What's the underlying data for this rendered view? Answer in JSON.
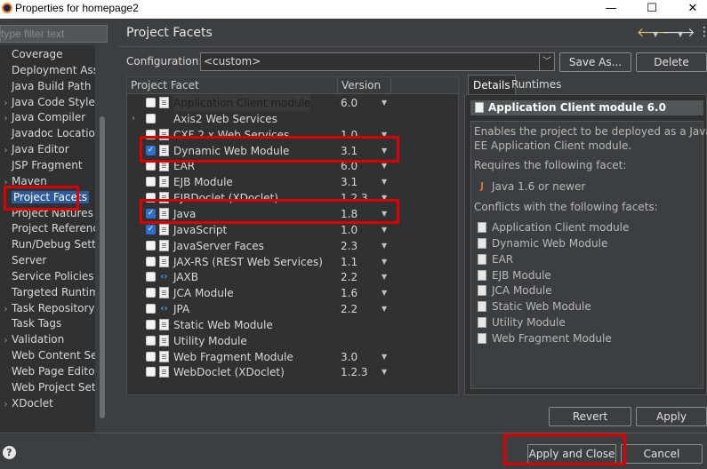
{
  "window": {
    "title": "Properties for homepage2",
    "minimize": "—",
    "maximize": "☐",
    "close": "✕"
  },
  "leftnav": {
    "filter_placeholder": "type filter text",
    "items": [
      {
        "label": "Coverage",
        "arrow": ""
      },
      {
        "label": "Deployment Assembly",
        "arrow": ""
      },
      {
        "label": "Java Build Path",
        "arrow": ""
      },
      {
        "label": "Java Code Style",
        "arrow": "›"
      },
      {
        "label": "Java Compiler",
        "arrow": "›"
      },
      {
        "label": "Javadoc Location",
        "arrow": ""
      },
      {
        "label": "Java Editor",
        "arrow": "›"
      },
      {
        "label": "JSP Fragment",
        "arrow": ""
      },
      {
        "label": "Maven",
        "arrow": "›"
      },
      {
        "label": "Project Facets",
        "arrow": "",
        "selected": true
      },
      {
        "label": "Project Natures",
        "arrow": ""
      },
      {
        "label": "Project References",
        "arrow": ""
      },
      {
        "label": "Run/Debug Settings",
        "arrow": ""
      },
      {
        "label": "Server",
        "arrow": ""
      },
      {
        "label": "Service Policies",
        "arrow": ""
      },
      {
        "label": "Targeted Runtimes",
        "arrow": ""
      },
      {
        "label": "Task Repository",
        "arrow": "›"
      },
      {
        "label": "Task Tags",
        "arrow": ""
      },
      {
        "label": "Validation",
        "arrow": "›"
      },
      {
        "label": "Web Content Settings",
        "arrow": ""
      },
      {
        "label": "Web Page Editor",
        "arrow": ""
      },
      {
        "label": "Web Project Settings",
        "arrow": ""
      },
      {
        "label": "XDoclet",
        "arrow": "›"
      }
    ]
  },
  "header": {
    "title": "Project Facets",
    "back_icon": "back-arrow-icon",
    "forward_icon": "forward-arrow-icon",
    "menu_icon": "kebab-menu-icon"
  },
  "configuration": {
    "label": "Configuration:",
    "value": "<custom>",
    "save_as": "Save As...",
    "delete": "Delete"
  },
  "facets": {
    "col_facet": "Project Facet",
    "col_version": "Version",
    "rows": [
      {
        "name": "Application Client module",
        "version": "6.0",
        "checked": false,
        "expandable": false,
        "icon": "doc",
        "dim": true
      },
      {
        "name": "Axis2 Web Services",
        "version": "",
        "checked": false,
        "expandable": true,
        "icon": "none"
      },
      {
        "name": "CXF 2.x Web Services",
        "version": "1.0",
        "checked": false,
        "expandable": false,
        "icon": "doc"
      },
      {
        "name": "Dynamic Web Module",
        "version": "3.1",
        "checked": true,
        "expandable": false,
        "icon": "web"
      },
      {
        "name": "EAR",
        "version": "6.0",
        "checked": false,
        "expandable": false,
        "icon": "doc"
      },
      {
        "name": "EJB Module",
        "version": "3.1",
        "checked": false,
        "expandable": false,
        "icon": "ejb"
      },
      {
        "name": "EJBDoclet (XDoclet)",
        "version": "1.2.3",
        "checked": false,
        "expandable": false,
        "icon": "doc"
      },
      {
        "name": "Java",
        "version": "1.8",
        "checked": true,
        "expandable": false,
        "icon": "java"
      },
      {
        "name": "JavaScript",
        "version": "1.0",
        "checked": true,
        "expandable": false,
        "icon": "js"
      },
      {
        "name": "JavaServer Faces",
        "version": "2.3",
        "checked": false,
        "expandable": false,
        "icon": "doc"
      },
      {
        "name": "JAX-RS (REST Web Services)",
        "version": "1.1",
        "checked": false,
        "expandable": false,
        "icon": "doc"
      },
      {
        "name": "JAXB",
        "version": "2.2",
        "checked": false,
        "expandable": false,
        "icon": "xml"
      },
      {
        "name": "JCA Module",
        "version": "1.6",
        "checked": false,
        "expandable": false,
        "icon": "doc"
      },
      {
        "name": "JPA",
        "version": "2.2",
        "checked": false,
        "expandable": false,
        "icon": "xml"
      },
      {
        "name": "Static Web Module",
        "version": "",
        "checked": false,
        "expandable": false,
        "icon": "doc"
      },
      {
        "name": "Utility Module",
        "version": "",
        "checked": false,
        "expandable": false,
        "icon": "doc"
      },
      {
        "name": "Web Fragment Module",
        "version": "3.0",
        "checked": false,
        "expandable": false,
        "icon": "doc"
      },
      {
        "name": "WebDoclet (XDoclet)",
        "version": "1.2.3",
        "checked": false,
        "expandable": false,
        "icon": "doc"
      }
    ]
  },
  "details": {
    "tab_details": "Details",
    "tab_runtimes": "Runtimes",
    "title": "Application Client module 6.0",
    "desc_line1": "Enables the project to be deployed as a Java",
    "desc_line2": "EE Application Client module.",
    "requires_label": "Requires the following facet:",
    "requires": [
      {
        "name": "Java 1.6 or newer",
        "icon": "java"
      }
    ],
    "conflicts_label": "Conflicts with the following facets:",
    "conflicts": [
      "Application Client module",
      "Dynamic Web Module",
      "EAR",
      "EJB Module",
      "JCA Module",
      "Static Web Module",
      "Utility Module",
      "Web Fragment Module"
    ]
  },
  "actions": {
    "revert": "Revert",
    "apply": "Apply",
    "apply_and_close": "Apply and Close",
    "cancel": "Cancel",
    "help": "?"
  },
  "colors": {
    "background": "#3c3f41",
    "panel": "#2f3133",
    "selection": "#2d5b9e",
    "checkbox_checked": "#2e6fd1",
    "highlight": "#e00000"
  }
}
